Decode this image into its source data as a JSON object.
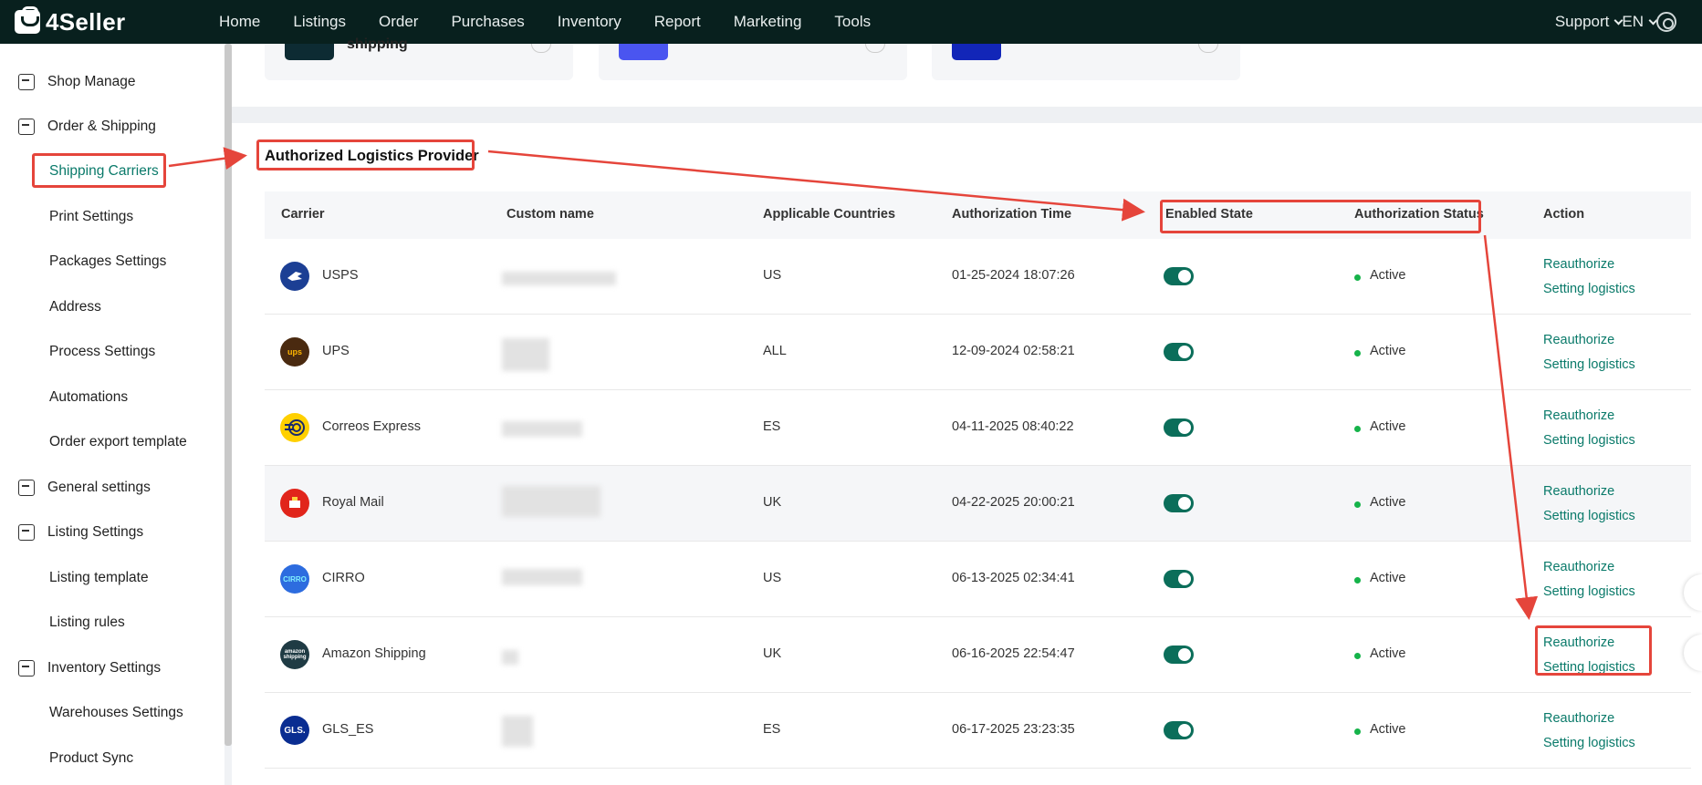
{
  "app": {
    "name": "4Seller"
  },
  "topnav": {
    "items": [
      "Home",
      "Listings",
      "Order",
      "Purchases",
      "Inventory",
      "Report",
      "Marketing",
      "Tools"
    ],
    "support": "Support",
    "language": "EN"
  },
  "sidebar": {
    "items": [
      {
        "label": "Shop Manage",
        "type": "group"
      },
      {
        "label": "Order & Shipping",
        "type": "group"
      },
      {
        "label": "Shipping Carriers",
        "type": "sub",
        "active": true
      },
      {
        "label": "Print Settings",
        "type": "sub"
      },
      {
        "label": "Packages Settings",
        "type": "sub"
      },
      {
        "label": "Address",
        "type": "sub"
      },
      {
        "label": "Process Settings",
        "type": "sub"
      },
      {
        "label": "Automations",
        "type": "sub"
      },
      {
        "label": "Order export template",
        "type": "sub"
      },
      {
        "label": "General settings",
        "type": "group"
      },
      {
        "label": "Listing Settings",
        "type": "group"
      },
      {
        "label": "Listing template",
        "type": "sub"
      },
      {
        "label": "Listing rules",
        "type": "sub"
      },
      {
        "label": "Inventory Settings",
        "type": "group"
      },
      {
        "label": "Warehouses Settings",
        "type": "sub"
      },
      {
        "label": "Product Sync",
        "type": "sub"
      }
    ]
  },
  "cards": {
    "first_label": "shipping"
  },
  "section": {
    "title": "Authorized Logistics Provider"
  },
  "table": {
    "headers": {
      "carrier": "Carrier",
      "custom_name": "Custom name",
      "countries": "Applicable Countries",
      "auth_time": "Authorization Time",
      "enabled": "Enabled State",
      "auth_status": "Authorization Status",
      "action": "Action"
    },
    "rows": [
      {
        "carrier": "USPS",
        "logo_icon": "usps-eagle-icon",
        "logo_color": "#1c3f94",
        "countries": "US",
        "auth_time": "01-25-2024 18:07:26",
        "enabled": true,
        "status": "Active",
        "action1": "Reauthorize",
        "action2": "Setting logistics"
      },
      {
        "carrier": "UPS",
        "logo_icon": "ups-shield-icon",
        "logo_color": "#4a2a10",
        "logo_text": "ups",
        "countries": "ALL",
        "auth_time": "12-09-2024 02:58:21",
        "enabled": true,
        "status": "Active",
        "action1": "Reauthorize",
        "action2": "Setting logistics"
      },
      {
        "carrier": "Correos Express",
        "logo_icon": "correos-express-icon",
        "logo_color": "#ffd000",
        "countries": "ES",
        "auth_time": "04-11-2025 08:40:22",
        "enabled": true,
        "status": "Active",
        "action1": "Reauthorize",
        "action2": "Setting logistics"
      },
      {
        "carrier": "Royal Mail",
        "logo_icon": "royal-mail-icon",
        "logo_color": "#e1251b",
        "countries": "UK",
        "auth_time": "04-22-2025 20:00:21",
        "enabled": true,
        "status": "Active",
        "action1": "Reauthorize",
        "action2": "Setting logistics"
      },
      {
        "carrier": "CIRRO",
        "logo_icon": "cirro-icon",
        "logo_color": "#2d6cdf",
        "logo_text": "CIRRO",
        "countries": "US",
        "auth_time": "06-13-2025 02:34:41",
        "enabled": true,
        "status": "Active",
        "action1": "Reauthorize",
        "action2": "Setting logistics"
      },
      {
        "carrier": "Amazon Shipping",
        "logo_icon": "amazon-shipping-icon",
        "logo_color": "#1f3b44",
        "logo_text": "amazon shipping",
        "countries": "UK",
        "auth_time": "06-16-2025 22:54:47",
        "enabled": true,
        "status": "Active",
        "action1": "Reauthorize",
        "action2": "Setting logistics"
      },
      {
        "carrier": "GLS_ES",
        "logo_icon": "gls-icon",
        "logo_color": "#0a2d91",
        "logo_text": "GLS.",
        "countries": "ES",
        "auth_time": "06-17-2025 23:23:35",
        "enabled": true,
        "status": "Active",
        "action1": "Reauthorize",
        "action2": "Setting logistics"
      }
    ]
  },
  "colors": {
    "accent": "#0a7a6a",
    "topbar": "#08201e",
    "toggle_on": "#0b6e5a",
    "status_active": "#16b34a",
    "annotation": "#e5453b"
  }
}
